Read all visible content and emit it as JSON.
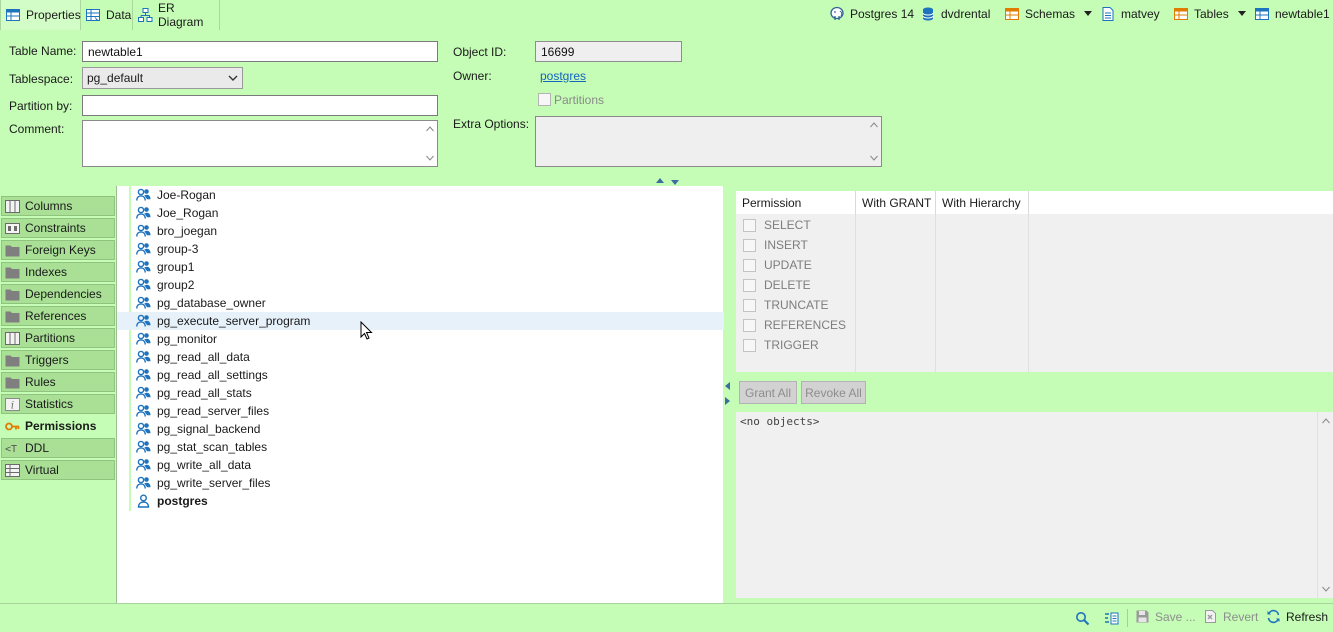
{
  "tabs": [
    {
      "label": "Properties",
      "active": true
    },
    {
      "label": "Data"
    },
    {
      "label": "ER Diagram"
    }
  ],
  "breadcrumb": [
    {
      "label": "Postgres 14",
      "icon": "elephant-icon"
    },
    {
      "label": "dvdrental",
      "icon": "database-icon"
    },
    {
      "label": "Schemas",
      "icon": "schemas-icon"
    },
    {
      "label": "matvey",
      "icon": "schema-icon"
    },
    {
      "label": "Tables",
      "icon": "tables-folder-icon"
    },
    {
      "label": "newtable1",
      "icon": "table-icon"
    }
  ],
  "form": {
    "table_name_label": "Table Name:",
    "table_name_value": "newtable1",
    "tablespace_label": "Tablespace:",
    "tablespace_value": "pg_default",
    "partition_by_label": "Partition by:",
    "partition_by_value": "",
    "comment_label": "Comment:",
    "comment_value": "",
    "object_id_label": "Object ID:",
    "object_id_value": "16699",
    "owner_label": "Owner:",
    "owner_value": "postgres",
    "partitions_label": "Partitions",
    "extra_options_label": "Extra Options:",
    "extra_options_value": ""
  },
  "sidenav": [
    {
      "label": "Columns",
      "icon": "columns-icon"
    },
    {
      "label": "Constraints",
      "icon": "constraints-icon"
    },
    {
      "label": "Foreign Keys",
      "icon": "folder-icon"
    },
    {
      "label": "Indexes",
      "icon": "folder-icon"
    },
    {
      "label": "Dependencies",
      "icon": "folder-icon"
    },
    {
      "label": "References",
      "icon": "folder-icon"
    },
    {
      "label": "Partitions",
      "icon": "columns-icon"
    },
    {
      "label": "Triggers",
      "icon": "folder-icon"
    },
    {
      "label": "Rules",
      "icon": "folder-icon"
    },
    {
      "label": "Statistics",
      "icon": "info-icon"
    },
    {
      "label": "Permissions",
      "icon": "key-icon",
      "active": true
    },
    {
      "label": "DDL",
      "icon": "ddl-icon"
    },
    {
      "label": "Virtual",
      "icon": "virtual-icon"
    }
  ],
  "users": [
    {
      "name": "Joe-Rogan",
      "type": "group"
    },
    {
      "name": "Joe_Rogan",
      "type": "group"
    },
    {
      "name": "bro_joegan",
      "type": "group"
    },
    {
      "name": "group-3",
      "type": "group"
    },
    {
      "name": "group1",
      "type": "group"
    },
    {
      "name": "group2",
      "type": "group"
    },
    {
      "name": "pg_database_owner",
      "type": "group"
    },
    {
      "name": "pg_execute_server_program",
      "type": "group",
      "hover": true
    },
    {
      "name": "pg_monitor",
      "type": "group"
    },
    {
      "name": "pg_read_all_data",
      "type": "group"
    },
    {
      "name": "pg_read_all_settings",
      "type": "group"
    },
    {
      "name": "pg_read_all_stats",
      "type": "group"
    },
    {
      "name": "pg_read_server_files",
      "type": "group"
    },
    {
      "name": "pg_signal_backend",
      "type": "group"
    },
    {
      "name": "pg_stat_scan_tables",
      "type": "group"
    },
    {
      "name": "pg_write_all_data",
      "type": "group"
    },
    {
      "name": "pg_write_server_files",
      "type": "group"
    },
    {
      "name": "postgres",
      "type": "user",
      "bold": true
    }
  ],
  "permissions": {
    "headers": [
      "Permission",
      "With GRANT",
      "With Hierarchy"
    ],
    "rows": [
      "SELECT",
      "INSERT",
      "UPDATE",
      "DELETE",
      "TRUNCATE",
      "REFERENCES",
      "TRIGGER"
    ]
  },
  "buttons": {
    "grant_all": "Grant All",
    "revoke_all": "Revoke All"
  },
  "objects_text": "<no objects>",
  "bottombar": {
    "save": "Save ...",
    "revert": "Revert",
    "refresh": "Refresh"
  },
  "colors": {
    "background": "#c5fcb6",
    "nav_item": "#a9e096",
    "link": "#1565c0",
    "group_icon": "#1e73be"
  }
}
